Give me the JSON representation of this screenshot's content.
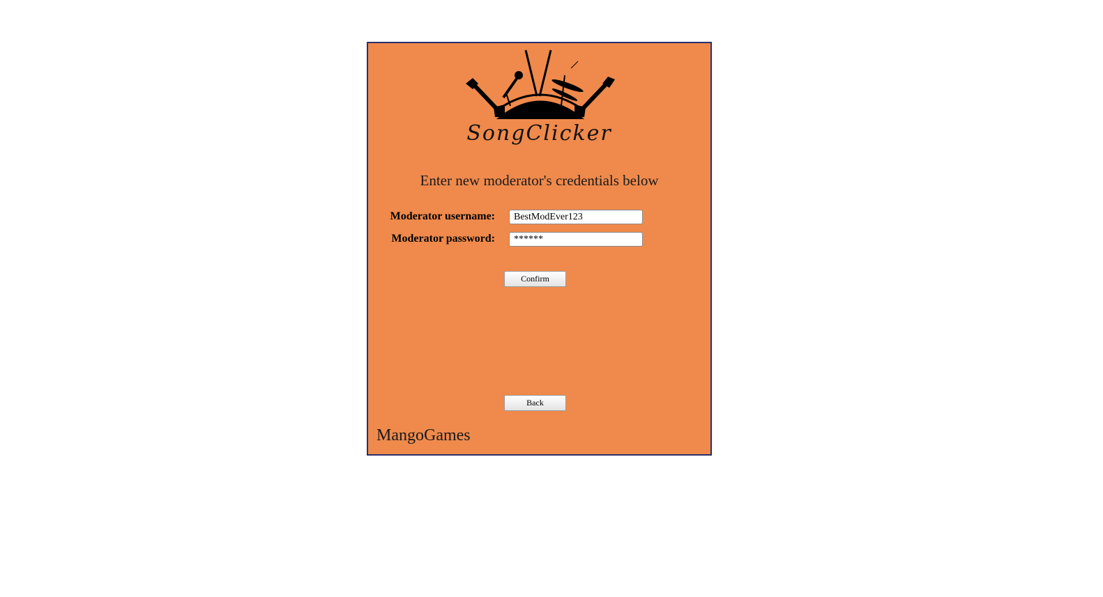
{
  "brand": {
    "name": "SongClicker"
  },
  "form": {
    "heading": "Enter new moderator's credentials below",
    "username_label": "Moderator username:",
    "username_value": "BestModEver123",
    "password_label": "Moderator password:",
    "password_value": "******"
  },
  "buttons": {
    "confirm": "Confirm",
    "back": "Back"
  },
  "footer": {
    "company": "MangoGames"
  },
  "colors": {
    "panel_bg": "#ef8a4c",
    "panel_border": "#2b2f6b"
  }
}
